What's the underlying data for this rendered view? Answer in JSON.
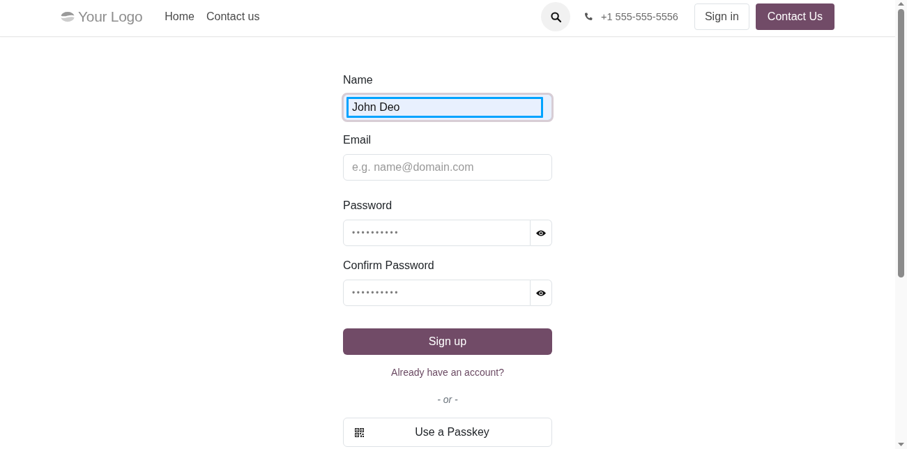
{
  "header": {
    "logo": "Your Logo",
    "nav": [
      {
        "label": "Home"
      },
      {
        "label": "Contact us"
      }
    ],
    "phone": "+1 555-555-5556",
    "sign_in": "Sign in",
    "cta": "Contact Us"
  },
  "form": {
    "fields": [
      {
        "kind": "text",
        "label": "Name",
        "value": "John Deo",
        "focused": true
      },
      {
        "kind": "text",
        "label": "Email",
        "placeholder": "e.g. name@domain.com",
        "focused": false
      },
      {
        "kind": "password",
        "label": "Password",
        "value": "••••••••••",
        "focused": false
      },
      {
        "kind": "password",
        "label": "Confirm Password",
        "value": "••••••••••",
        "focused": false
      }
    ],
    "submit": "Sign up",
    "login_link": "Already have an account?",
    "separator": "- or -",
    "passkey": "Use a Passkey"
  }
}
